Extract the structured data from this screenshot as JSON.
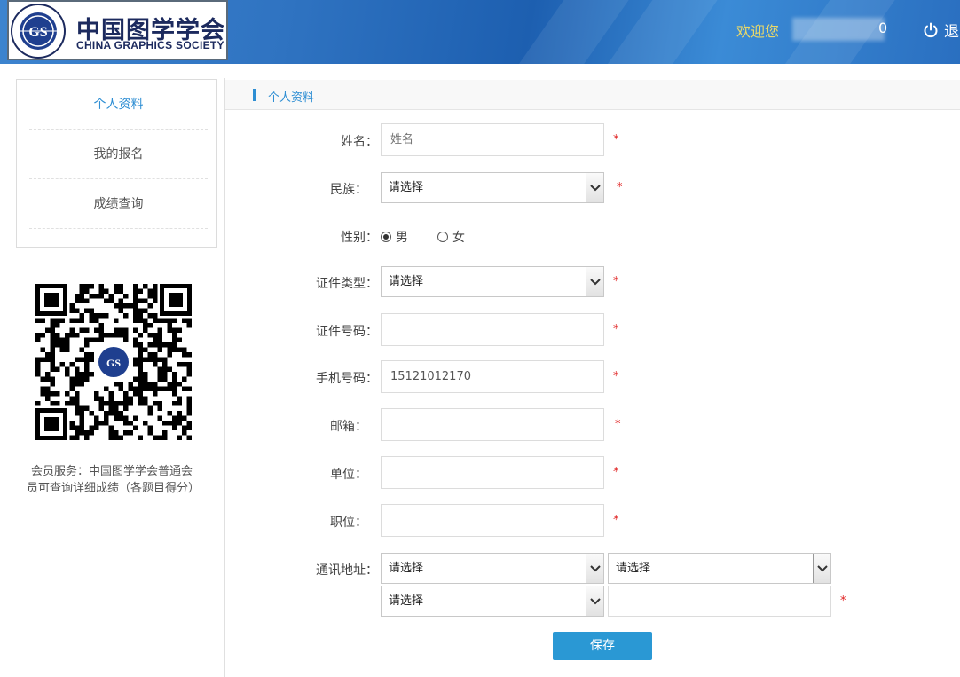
{
  "header": {
    "logo_cn": "中国图学学会",
    "logo_en": "CHINA GRAPHICS SOCIETY",
    "welcome": "欢迎您",
    "username_tail": "0",
    "logout_label": "退"
  },
  "sidebar": {
    "items": [
      {
        "label": "个人资料",
        "active": true
      },
      {
        "label": "我的报名",
        "active": false
      },
      {
        "label": "成绩查询",
        "active": false
      }
    ],
    "member_note": "会员服务：中国图学学会普通会员可查询详细成绩（各题目得分）"
  },
  "section": {
    "title": "个人资料"
  },
  "form": {
    "name": {
      "label": "姓名：",
      "placeholder": "姓名",
      "value": ""
    },
    "ethnicity": {
      "label": "民族：",
      "selected": "请选择"
    },
    "gender": {
      "label": "性别：",
      "options": [
        "男",
        "女"
      ],
      "selected": "男"
    },
    "id_type": {
      "label": "证件类型：",
      "selected": "请选择"
    },
    "id_number": {
      "label": "证件号码：",
      "value": ""
    },
    "mobile": {
      "label": "手机号码：",
      "value": "15121012170"
    },
    "email": {
      "label": "邮箱：",
      "value": ""
    },
    "organization": {
      "label": "单位：",
      "value": ""
    },
    "position": {
      "label": "职位：",
      "value": ""
    },
    "address": {
      "label": "通讯地址：",
      "province": "请选择",
      "city": "请选择",
      "district": "请选择",
      "detail": ""
    },
    "required_mark": "*",
    "save_label": "保存"
  },
  "colors": {
    "accent": "#2e8ed3",
    "button": "#2a98d4",
    "required": "#e02020",
    "welcome": "#e8d86a"
  },
  "icons": [
    "gs-seal-logo",
    "power-icon",
    "qr-code",
    "chevron-down-icon"
  ]
}
